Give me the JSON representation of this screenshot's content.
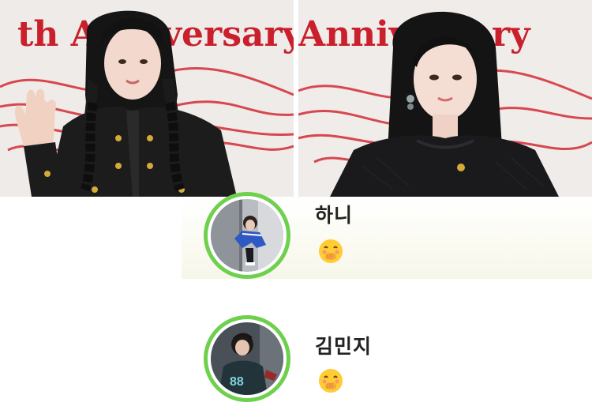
{
  "collage": {
    "left_photo": {
      "backdrop_text": "th Anniversary",
      "backdrop_color": "#c9202c",
      "subject": "person-waving"
    },
    "right_photo": {
      "backdrop_text": "Anniversary",
      "backdrop_color": "#c9202c",
      "subject": "person-portrait"
    }
  },
  "members": [
    {
      "name": "하니",
      "reaction_icon": "hand-over-mouth-emoji",
      "ring_color": "#6ed04d"
    },
    {
      "name": "김민지",
      "reaction_icon": "hand-over-mouth-emoji",
      "ring_color": "#6ed04d"
    }
  ]
}
